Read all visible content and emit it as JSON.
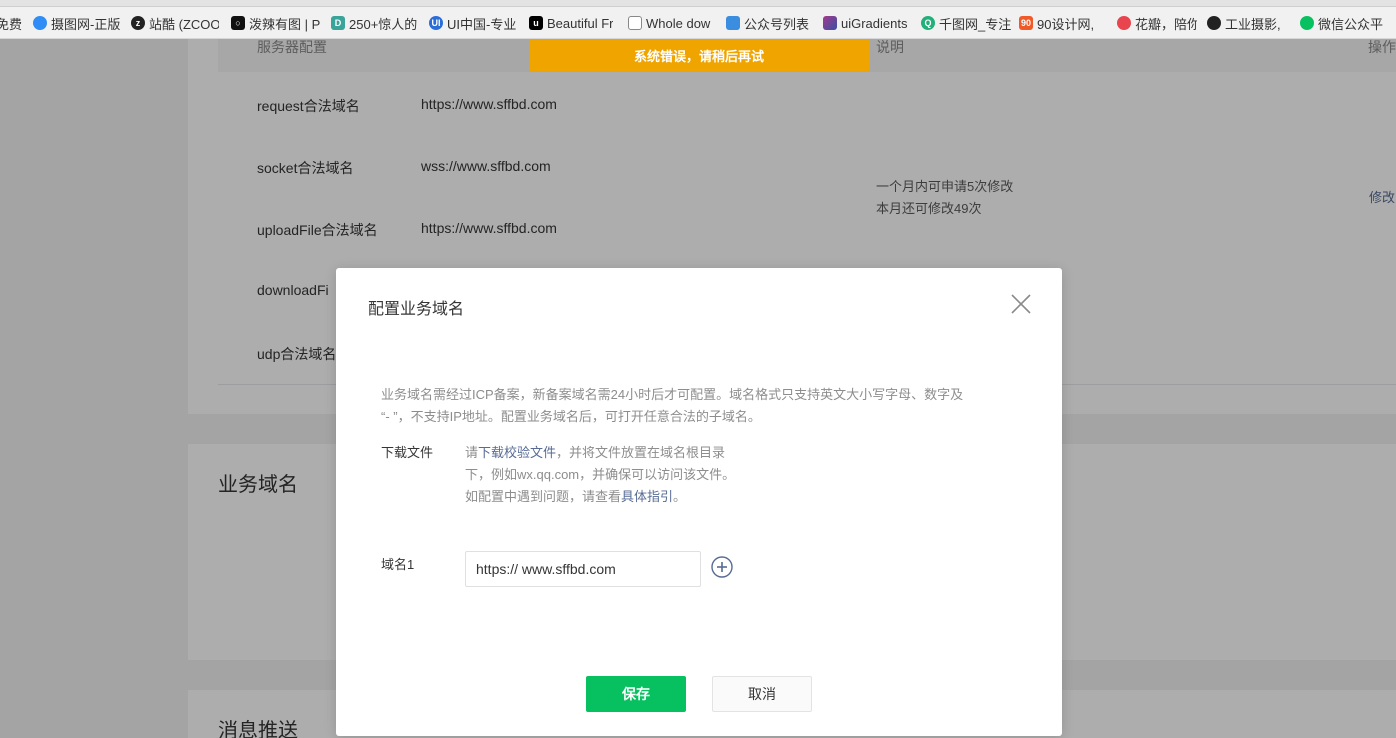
{
  "bookmarks": [
    {
      "label": "免费",
      "icon_color": "#e8e8e8"
    },
    {
      "label": "摄图网-正版",
      "icon_color": "#2f8df5"
    },
    {
      "label": "站酷 (ZCOO",
      "icon_color": "#222222"
    },
    {
      "label": "泼辣有图 | P",
      "icon_color": "#111111"
    },
    {
      "label": "250+惊人的",
      "icon_color": "#3aa39a"
    },
    {
      "label": "UI中国-专业",
      "icon_color": "#2a6cd8"
    },
    {
      "label": "Beautiful Fr",
      "icon_color": "#000000"
    },
    {
      "label": "Whole dow",
      "icon_color": "#ffffff"
    },
    {
      "label": "公众号列表",
      "icon_color": "#3b8de0"
    },
    {
      "label": "uiGradients",
      "icon_color": "#a23a8c"
    },
    {
      "label": "千图网_专注",
      "icon_color": "#22b07a"
    },
    {
      "label": "90设计网,",
      "icon_color": "#f05a28"
    },
    {
      "label": "花瓣，陪你",
      "icon_color": "#e8454f"
    },
    {
      "label": "工业摄影,",
      "icon_color": "#222222"
    },
    {
      "label": "微信公众平",
      "icon_color": "#07c160"
    }
  ],
  "server_table": {
    "header_col1": "服务器配置",
    "header_col3": "说明",
    "header_col4": "操作",
    "rows": [
      {
        "label": "request合法域名",
        "value": "https://www.sffbd.com"
      },
      {
        "label": "socket合法域名",
        "value": "wss://www.sffbd.com"
      },
      {
        "label": "uploadFile合法域名",
        "value": "https://www.sffbd.com"
      },
      {
        "label": "downloadFi",
        "value": ""
      },
      {
        "label": "udp合法域名",
        "value": ""
      }
    ],
    "note_line1": "一个月内可申请5次修改",
    "note_line2": "本月还可修改49次",
    "edit_link": "修改"
  },
  "section_business": "业务域名",
  "section_message": "消息推送",
  "toast": "系统错误，请稍后再试",
  "dialog": {
    "title": "配置业务域名",
    "desc_line1": "业务域名需经过ICP备案，新备案域名需24小时后才可配置。域名格式只支持英文大小写字母、数字及",
    "desc_line2": "“- ”，不支持IP地址。配置业务域名后，可打开任意合法的子域名。",
    "download_label": "下载文件",
    "guide_prefix": "请",
    "guide_link1": "下载校验文件",
    "guide_mid": "，并将文件放置在域名根目录下，例如wx.qq.com，并确保可以访问该文件。如配置中遇到问题，请查看",
    "guide_link2": "具体指引",
    "guide_suffix": "。",
    "domain_label": "域名1",
    "domain_value": "https:// www.sffbd.com",
    "save_label": "保存",
    "cancel_label": "取消"
  },
  "colors": {
    "primary": "#07c160",
    "toast": "#f0a400",
    "link": "#576b95"
  }
}
